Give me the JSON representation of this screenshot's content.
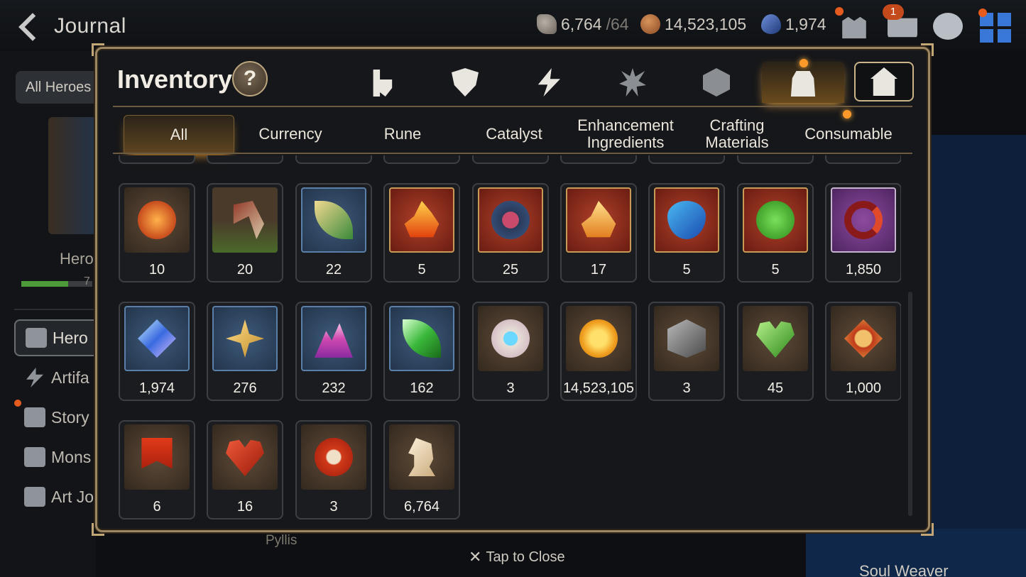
{
  "header": {
    "back_label": "Journal",
    "resources": [
      {
        "icon": "skystone-icon",
        "value": "6,764",
        "sub": "/64"
      },
      {
        "icon": "gold-icon",
        "value": "14,523,105",
        "sub": ""
      },
      {
        "icon": "crystal-icon",
        "value": "1,974",
        "sub": ""
      }
    ],
    "mail_count": "1"
  },
  "background": {
    "filter_label": "All Heroes",
    "hero_label": "Hero",
    "hero_progress_text": "7",
    "hero_progress": 0.66,
    "nav": [
      "Hero",
      "Artifa",
      "Story",
      "Mons",
      "Art Jo"
    ],
    "pyllis": "Pyllis",
    "soul_weaver": "Soul Weaver"
  },
  "modal": {
    "title": "Inventory",
    "help": "?",
    "category_tabs": [
      "armor-icon",
      "shield-icon",
      "bolt-icon",
      "splat-icon",
      "cube-icon",
      "bag-icon",
      "house-icon"
    ],
    "active_category": "bag-icon",
    "sub_tabs": [
      "All",
      "Currency",
      "Rune",
      "Catalyst",
      "Enhancement Ingredients",
      "Crafting Materials",
      "Consumable"
    ],
    "active_sub_tab": "All",
    "rows": [
      [
        {
          "icon": "red-orb-icon",
          "qty": "10",
          "frame": "brown"
        },
        {
          "icon": "claw-icon",
          "qty": "20",
          "frame": "green"
        },
        {
          "icon": "feather-herb-icon",
          "qty": "22",
          "frame": "blue"
        },
        {
          "icon": "flame-rune-icon",
          "qty": "5",
          "frame": "red"
        },
        {
          "icon": "disc-rune-icon",
          "qty": "25",
          "frame": "red"
        },
        {
          "icon": "crystal-flame-rune-icon",
          "qty": "17",
          "frame": "red"
        },
        {
          "icon": "drop-rune-icon",
          "qty": "5",
          "frame": "red"
        },
        {
          "icon": "tree-rune-icon",
          "qty": "5",
          "frame": "red"
        },
        {
          "icon": "ring-rune-icon",
          "qty": "1,850",
          "frame": "purple"
        }
      ],
      [
        {
          "icon": "blue-crystal-icon",
          "qty": "1,974",
          "frame": "blue"
        },
        {
          "icon": "star-amulet-icon",
          "qty": "276",
          "frame": "blue"
        },
        {
          "icon": "pink-mountain-icon",
          "qty": "232",
          "frame": "blue"
        },
        {
          "icon": "green-leaf-icon",
          "qty": "162",
          "frame": "blue"
        },
        {
          "icon": "charm-icon",
          "qty": "3",
          "frame": "brown"
        },
        {
          "icon": "gold-coin-icon",
          "qty": "14,523,105",
          "frame": "brown"
        },
        {
          "icon": "stone-cube-icon",
          "qty": "3",
          "frame": "brown"
        },
        {
          "icon": "green-heart-icon",
          "qty": "45",
          "frame": "brown"
        },
        {
          "icon": "fist-badge-icon",
          "qty": "1,000",
          "frame": "brown"
        }
      ],
      [
        {
          "icon": "banner-icon",
          "qty": "6",
          "frame": "brown"
        },
        {
          "icon": "red-leaf-icon",
          "qty": "16",
          "frame": "brown"
        },
        {
          "icon": "seal-icon",
          "qty": "3",
          "frame": "brown"
        },
        {
          "icon": "knight-piece-icon",
          "qty": "6,764",
          "frame": "brown"
        }
      ]
    ],
    "tap_to_close": "Tap to Close"
  },
  "colors": {
    "modal_border": "#9d8763",
    "active_tab_glow": "#f0a030",
    "accent_blue": "#3a78d8"
  }
}
